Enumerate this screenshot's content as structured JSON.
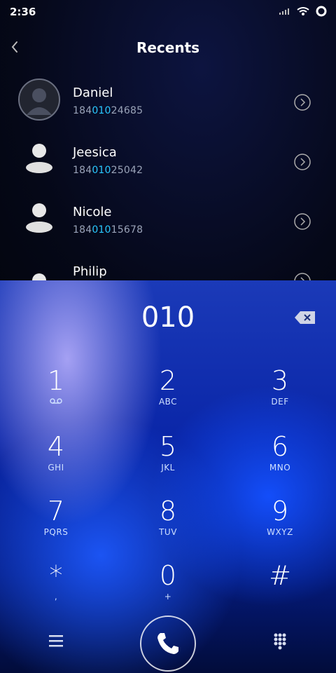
{
  "status": {
    "time": "2:36"
  },
  "header": {
    "title": "Recents"
  },
  "recents": [
    {
      "name": "Daniel",
      "num_pre": "184",
      "num_hl": "010",
      "num_post": "24685"
    },
    {
      "name": "Jeesica",
      "num_pre": "184",
      "num_hl": "010",
      "num_post": "25042"
    },
    {
      "name": "Nicole",
      "num_pre": "184",
      "num_hl": "010",
      "num_post": "15678"
    },
    {
      "name": "Philip",
      "num_pre": "",
      "num_hl": "",
      "num_post": ""
    }
  ],
  "dialer": {
    "entered": "010",
    "keys": [
      {
        "digit": "1",
        "letters": ""
      },
      {
        "digit": "2",
        "letters": "ABC"
      },
      {
        "digit": "3",
        "letters": "DEF"
      },
      {
        "digit": "4",
        "letters": "GHI"
      },
      {
        "digit": "5",
        "letters": "JKL"
      },
      {
        "digit": "6",
        "letters": "MNO"
      },
      {
        "digit": "7",
        "letters": "PQRS"
      },
      {
        "digit": "8",
        "letters": "TUV"
      },
      {
        "digit": "9",
        "letters": "WXYZ"
      },
      {
        "digit": "*",
        "letters": ","
      },
      {
        "digit": "0",
        "letters": "+"
      },
      {
        "digit": "#",
        "letters": ""
      }
    ]
  },
  "icons": {
    "back": "chevron-left-icon",
    "info": "chevron-right-circle-icon",
    "backspace": "backspace-icon",
    "voicemail": "voicemail-icon",
    "menu": "menu-icon",
    "call": "phone-icon",
    "dialpad": "dialpad-icon"
  }
}
